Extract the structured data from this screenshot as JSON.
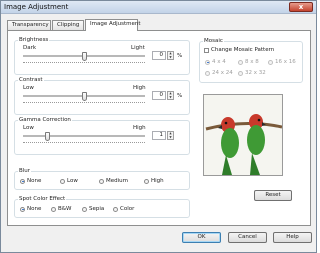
{
  "window": {
    "title": "Image Adjustment",
    "close_symbol": "x"
  },
  "tabs": [
    {
      "label": "Transparency"
    },
    {
      "label": "Clipping"
    },
    {
      "label": "Image Adjustment",
      "active": true
    }
  ],
  "brightness": {
    "title": "Brightness",
    "min_label": "Dark",
    "max_label": "Light",
    "value": "0",
    "unit": "%",
    "level": 0.5
  },
  "contrast": {
    "title": "Contrast",
    "min_label": "Low",
    "max_label": "High",
    "value": "0",
    "unit": "%",
    "level": 0.5
  },
  "gamma": {
    "title": "Gamma Correction",
    "min_label": "Low",
    "max_label": "High",
    "value": "1",
    "level": 0.2
  },
  "blur": {
    "title": "Blur",
    "options": [
      {
        "label": "None",
        "checked": true
      },
      {
        "label": "Low"
      },
      {
        "label": "Medium"
      },
      {
        "label": "High"
      }
    ]
  },
  "spot_color": {
    "title": "Spot Color Effect",
    "options": [
      {
        "label": "None",
        "checked": true
      },
      {
        "label": "B&W"
      },
      {
        "label": "Sepia"
      },
      {
        "label": "Color"
      }
    ]
  },
  "mosaic": {
    "title": "Mosaic",
    "change_label": "Change Mosaic Pattern",
    "options": [
      {
        "label": "4 x 4",
        "checked": true
      },
      {
        "label": "8 x 8"
      },
      {
        "label": "16 x 16"
      },
      {
        "label": "24 x 24"
      },
      {
        "label": "32 x 32"
      }
    ]
  },
  "buttons": {
    "reset": "Reset",
    "ok": "OK",
    "cancel": "Cancel",
    "help": "Help"
  },
  "colors": {
    "accent": "#2d6bc8",
    "bird_green": "#3f9a35",
    "bird_red": "#c8392b"
  }
}
